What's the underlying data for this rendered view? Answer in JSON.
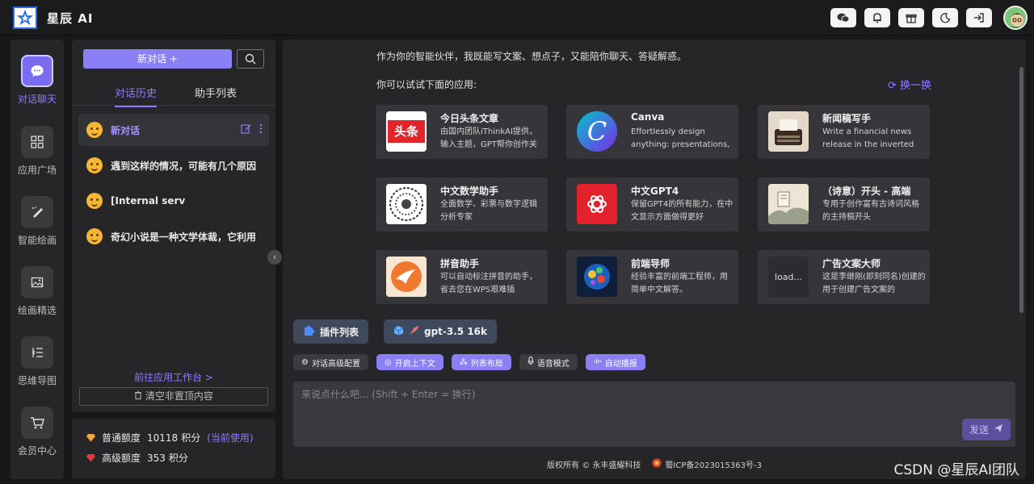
{
  "app": {
    "title": "星辰 AI"
  },
  "topbar": {
    "icons": [
      "wechat-icon",
      "bell-icon",
      "gift-icon",
      "moon-icon",
      "logout-icon"
    ]
  },
  "nav": [
    {
      "label": "对话聊天",
      "icon": "chat-icon",
      "active": true
    },
    {
      "label": "应用广场",
      "icon": "grid-icon"
    },
    {
      "label": "智能绘画",
      "icon": "brush-icon"
    },
    {
      "label": "绘画精选",
      "icon": "image-icon"
    },
    {
      "label": "思维导图",
      "icon": "mindmap-icon"
    },
    {
      "label": "会员中心",
      "icon": "cart-icon"
    }
  ],
  "sidebar": {
    "new_chat": "新对话 +",
    "tabs": [
      "对话历史",
      "助手列表"
    ],
    "chats": [
      {
        "title": "新对话"
      },
      {
        "title": "遇到这样的情况，可能有几个原因"
      },
      {
        "title": "[Internal serv"
      },
      {
        "title": "奇幻小说是一种文学体裁，它利用"
      }
    ],
    "goto_workbench": "前往应用工作台 >",
    "clear": "清空非置顶内容"
  },
  "quota": {
    "normal": {
      "label": "普通额度",
      "value": "10118",
      "unit": "积分",
      "note": "(当前使用)"
    },
    "advanced": {
      "label": "高级额度",
      "value": "353",
      "unit": "积分"
    }
  },
  "main": {
    "intro": "作为你的智能伙伴，我既能写文案、想点子，又能陪你聊天、答疑解惑。",
    "try_label": "你可以试试下面的应用:",
    "refresh": "换一换",
    "apps": [
      {
        "title": "今日头条文章",
        "desc": "由国内团队iThinkAI提供，输入主题，GPT帮你创作关",
        "badge": "头条"
      },
      {
        "title": "Canva",
        "desc": "Effortlessly design anything: presentations,",
        "badge": "C"
      },
      {
        "title": "新闻稿写手",
        "desc": "Write a financial news release in the inverted"
      },
      {
        "title": "中文数学助手",
        "desc": "全面数学、彩票与数字逻辑分析专家"
      },
      {
        "title": "中文GPT4",
        "desc": "保留GPT4的所有能力，在中文显示方面做得更好"
      },
      {
        "title": "（诗意）开头 - 高端",
        "desc": "专用于创作富有古诗词风格的主持稿开头"
      },
      {
        "title": "拼音助手",
        "desc": "可以自动标注拼音的助手，省去您在WPS艰难插"
      },
      {
        "title": "前端导师",
        "desc": "经验丰富的前端工程师，用简单中文解答。"
      },
      {
        "title": "广告文案大师",
        "desc": "这是李继刚(即刻同名)创建的用于创建广告文案的",
        "badge": "load..."
      }
    ],
    "plugin_chip": "插件列表",
    "model_chip": "gpt-3.5 16k",
    "tools": [
      "对话高级配置",
      "开启上下文",
      "列表布局",
      "语音模式",
      "自动播报"
    ],
    "placeholder": "来说点什么吧... (Shift + Enter = 换行)",
    "send": "发送",
    "footer_left": "版权所有 © 永丰盛耀科技",
    "footer_right": "蜀ICP备2023015363号-3"
  },
  "watermark": "CSDN @星辰AI团队",
  "colors": {
    "accent": "#8b7ff5",
    "bg": "#18181a",
    "panel": "#262628",
    "card": "#36363a"
  }
}
